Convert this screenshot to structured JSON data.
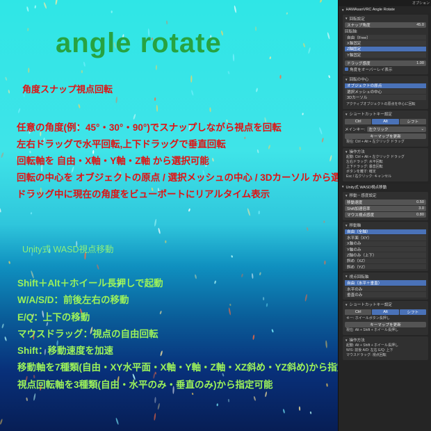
{
  "promo": {
    "title": "angle rotate",
    "angle_heading": "角度スナップ視点回転",
    "angle_lines": [
      "任意の角度(例：45°・30°・90°)でスナップしながら視点を回転",
      "左右ドラッグで水平回転,上下ドラッグで垂直回転",
      "回転軸を 自由・X軸・Y軸・Z軸 から選択可能",
      "回転の中心を オブジェクトの原点 / 選択メッシュの中心 / 3Dカーソル から選択可能",
      "ドラッグ中に現在の角度をビューポートにリアルタイム表示"
    ],
    "wasd_heading": "Unity式 WASD視点移動",
    "wasd_lines": [
      "Shift＋Alt＋ホイール長押しで起動",
      "W/A/S/D：前後左右の移動",
      "E/Q：上下の移動",
      "マウスドラッグ：視点の自由回転",
      "Shift：移動速度を加速",
      "移動軸を7種類(自由・XY水平面・X軸・Y軸・Z軸・XZ斜め・YZ斜め)から指定可能",
      "視点回転軸を3種類(自由・水平のみ・垂直のみ)から指定可能"
    ]
  },
  "panel": {
    "corner": "オプション",
    "angle_rotate": {
      "header": "HAMAsanVRC Angle Rotate",
      "rotation_settings": "回転設定",
      "snap_angle_label": "スナップ角度",
      "snap_angle_value": "45.0",
      "axis_label": "回転軸:",
      "axis_options": [
        "自由（Free）",
        "X軸固定",
        "Z軸固定",
        "Y軸固定"
      ],
      "axis_selected": 2,
      "drag_sensitivity_label": "ドラッグ感度",
      "drag_sensitivity_value": "1.00",
      "overlay_label": "角度をオーバーレイ表示",
      "center_header": "回転の中心",
      "center_options": [
        "オブジェクトの原点",
        "選択メッシュの中心",
        "3Dカーソル"
      ],
      "center_selected": 0,
      "active_note": "アクティブオブジェクトの原点を中心に回転",
      "shortcut_header": "ショートカットキー設定",
      "mod_keys": [
        "Ctrl",
        "Alt",
        "シフト"
      ],
      "mod_selected": 1,
      "mouse_key_label": "メインキー:",
      "mouse_key_value": "左クリック",
      "update_key_label": "キーマップを更新",
      "current_label": "現在: Ctrl + Alt + 左クリック ドラッグ",
      "usage_header": "操作方法",
      "usage_lines": [
        "起動: Ctrl + Alt + 左クリック ドラッグ",
        "左右ドラッグ: 水平回転",
        "上下ドラッグ: 垂直回転",
        "ボタンを離す: 確定",
        "Esc / 右クリック: キャンセル"
      ]
    },
    "wasd": {
      "header": "Unity式 WASD視点移動",
      "settings_header": "移動・感度設定",
      "move_speed_label": "移動速度",
      "move_speed_value": "0.50",
      "shift_label": "Shift加速倍率",
      "shift_value": "3.0",
      "mouse_label": "マウス視点感度",
      "mouse_value": "0.80",
      "move_axis_header": "移動軸",
      "move_axis_options": [
        "自由（全軸）",
        "水平面（XY）",
        "X軸のみ",
        "Y軸のみ",
        "Z軸のみ（上下）",
        "斜め（XZ）",
        "斜め（YZ）"
      ],
      "move_axis_selected": 0,
      "view_axis_header": "視点回転軸",
      "view_axis_options": [
        "自由（水平＋垂直）",
        "水平のみ",
        "垂直のみ"
      ],
      "view_axis_selected": 0,
      "shortcut_header": "ショートカットキー設定",
      "mod_keys": [
        "Ctrl",
        "Alt",
        "シフト"
      ],
      "mod_selected": [
        1,
        2
      ],
      "key_label": "キー: ホイールボタン長押し",
      "update_key_label": "キーマップを更新",
      "current_label": "現在: Alt + Shift + ホイール長押し",
      "usage_header": "操作方法",
      "usage_lines": [
        "起動: Alt + Shift + ホイール長押し",
        "W/S: 前後  A/D: 左右  E/Q: 上下",
        "マウスドラッグ: 視点回転"
      ]
    }
  }
}
